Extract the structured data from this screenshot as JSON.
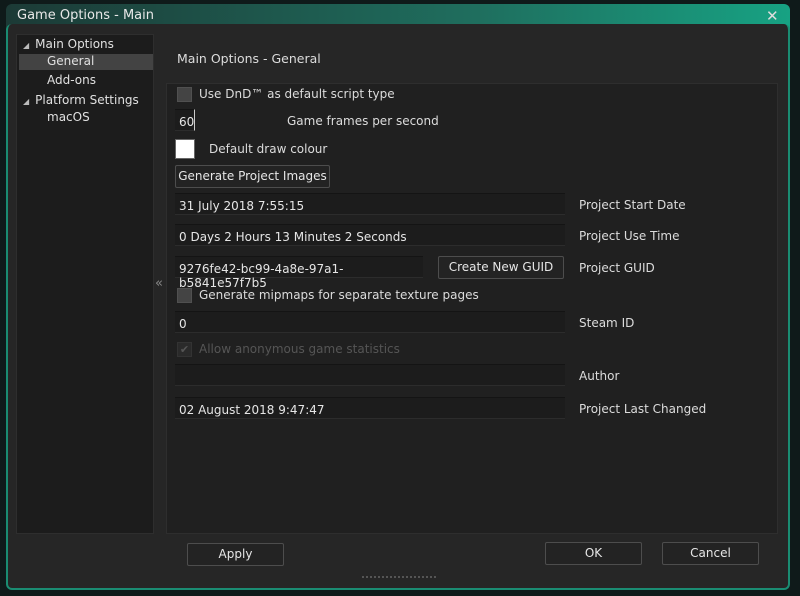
{
  "window": {
    "title": "Game Options - Main",
    "close_icon": "x-icon"
  },
  "sidebar": {
    "items": [
      {
        "label": "Main Options",
        "expanded": true
      },
      {
        "label": "General",
        "selected": true
      },
      {
        "label": "Add-ons"
      },
      {
        "label": "Platform Settings",
        "expanded": true
      },
      {
        "label": "macOS"
      }
    ],
    "collapse_glyph": "«"
  },
  "main": {
    "heading": "Main Options - General",
    "use_dnd": {
      "label": "Use DnD™ as default script type",
      "checked": false
    },
    "fps": {
      "value": "60",
      "label": "Game frames per second"
    },
    "draw_colour": {
      "label": "Default draw colour",
      "color": "#ffffff"
    },
    "generate_images_label": "Generate Project Images",
    "start_date": {
      "value": "31 July 2018 7:55:15",
      "label": "Project Start Date"
    },
    "use_time": {
      "value": "0 Days 2 Hours 13 Minutes 2 Seconds",
      "label": "Project Use Time"
    },
    "guid": {
      "value": "9276fe42-bc99-4a8e-97a1-b5841e57f7b5",
      "button": "Create New GUID",
      "label": "Project GUID"
    },
    "mipmaps": {
      "label": "Generate mipmaps for separate texture pages",
      "checked": false
    },
    "steam": {
      "value": "0",
      "label": "Steam ID"
    },
    "anon_stats": {
      "label": "Allow anonymous game statistics",
      "checked": true,
      "disabled": true
    },
    "author": {
      "value": "",
      "label": "Author"
    },
    "last_changed": {
      "value": "02 August 2018 9:47:47",
      "label": "Project Last Changed"
    }
  },
  "footer": {
    "apply": "Apply",
    "ok": "OK",
    "cancel": "Cancel"
  },
  "colors": {
    "accent": "#17a283",
    "background": "#262626"
  }
}
